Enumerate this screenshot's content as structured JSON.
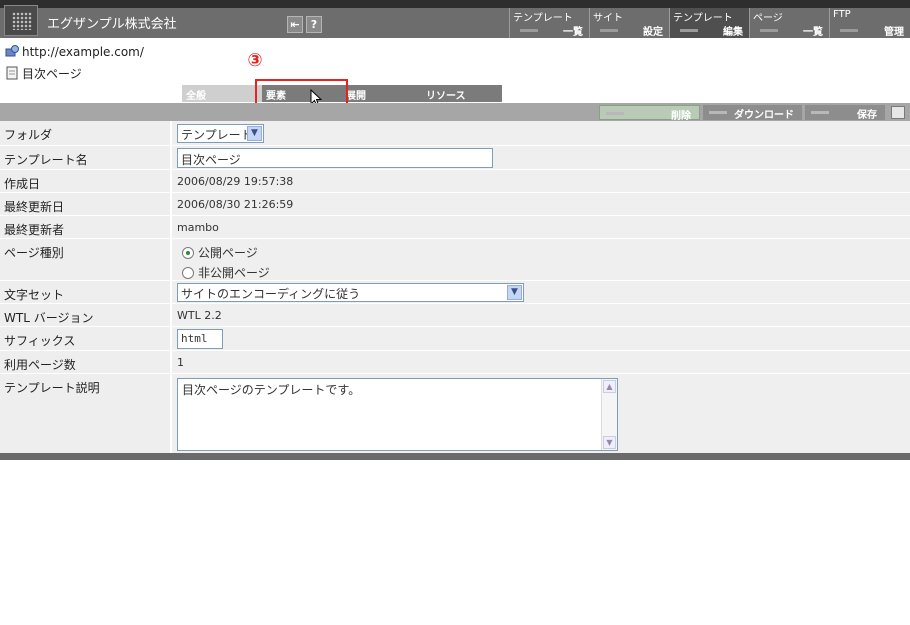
{
  "header": {
    "company": "エグザンプル株式会社",
    "icons": [
      "back-icon",
      "help-icon"
    ],
    "help_glyph": "?",
    "back_glyph": "⇤",
    "nav": [
      {
        "line1": "テンプレート",
        "line2": "一覧"
      },
      {
        "line1": "サイト",
        "line2": "設定"
      },
      {
        "line1": "テンプレート",
        "line2": "編集"
      },
      {
        "line1": "ページ",
        "line2": "一覧"
      },
      {
        "line1": "FTP",
        "line2": "管理"
      }
    ]
  },
  "location": {
    "url": "http://example.com/",
    "page": "目次ページ"
  },
  "tabs": [
    {
      "label": "全般"
    },
    {
      "label": "要素"
    },
    {
      "label": "展開"
    },
    {
      "label": "リソース"
    }
  ],
  "callout_number": "③",
  "actions": {
    "delete": "削除",
    "download": "ダウンロード",
    "save": "保存"
  },
  "form": {
    "folder": {
      "label": "フォルダ",
      "value": "テンプレート"
    },
    "template_name": {
      "label": "テンプレート名",
      "value": "目次ページ"
    },
    "created": {
      "label": "作成日",
      "value": "2006/08/29 19:57:38"
    },
    "updated": {
      "label": "最終更新日",
      "value": "2006/08/30 21:26:59"
    },
    "updater": {
      "label": "最終更新者",
      "value": "mambo"
    },
    "page_type": {
      "label": "ページ種別",
      "options": [
        "公開ページ",
        "非公開ページ"
      ],
      "selected": "公開ページ"
    },
    "charset": {
      "label": "文字セット",
      "value": "サイトのエンコーディングに従う"
    },
    "wtl_version": {
      "label": "WTL バージョン",
      "value": "WTL 2.2"
    },
    "suffix": {
      "label": "サフィックス",
      "value": "html"
    },
    "usage_count": {
      "label": "利用ページ数",
      "value": "1"
    },
    "description": {
      "label": "テンプレート説明",
      "value": "目次ページのテンプレートです。"
    }
  }
}
